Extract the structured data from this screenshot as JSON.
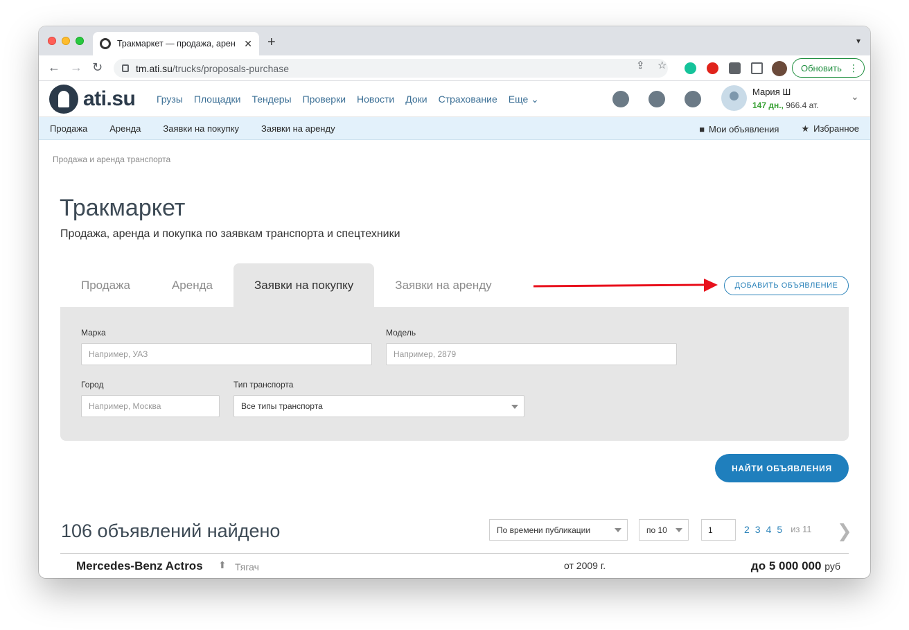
{
  "browser": {
    "tab_title": "Тракмаркет — продажа, арен",
    "url_host": "tm.ati.su",
    "url_path": "/trucks/proposals-purchase",
    "update_label": "Обновить"
  },
  "header": {
    "logo_text": "ati.su",
    "nav": [
      "Грузы",
      "Площадки",
      "Тендеры",
      "Проверки",
      "Новости",
      "Доки",
      "Страхование",
      "Еще"
    ],
    "user_name": "Мария Ш",
    "user_days": "147 дн.,",
    "user_balance": "966.4 ат."
  },
  "subnav": {
    "items": [
      "Продажа",
      "Аренда",
      "Заявки на покупку",
      "Заявки на аренду"
    ],
    "my_ads": "Мои объявления",
    "favorites": "Избранное"
  },
  "page": {
    "breadcrumb": "Продажа и аренда транспорта",
    "title": "Тракмаркет",
    "subtitle": "Продажа, аренда и покупка по заявкам транспорта и спецтехники",
    "tabs": [
      "Продажа",
      "Аренда",
      "Заявки на покупку",
      "Заявки на аренду"
    ],
    "active_tab": "Заявки на покупку",
    "add_button": "ДОБАВИТЬ ОБЪЯВЛЕНИЕ"
  },
  "filters": {
    "brand_label": "Марка",
    "brand_placeholder": "Например, УАЗ",
    "model_label": "Модель",
    "model_placeholder": "Например, 2879",
    "city_label": "Город",
    "city_placeholder": "Например, Москва",
    "type_label": "Тип транспорта",
    "type_value": "Все типы транспорта",
    "find_button": "НАЙТИ ОБЪЯВЛЕНИЯ"
  },
  "results": {
    "count_text": "106 объявлений найдено",
    "sort_value": "По времени публикации",
    "per_page": "по 10",
    "current_page": "1",
    "pages": [
      "2",
      "3",
      "4",
      "5"
    ],
    "of_total": "из 11",
    "items": [
      {
        "title": "Mercedes-Benz Actros",
        "type": "Тягач",
        "year": "от 2009 г.",
        "price_prefix": "до ",
        "price": "5 000 000",
        "currency": "руб"
      }
    ]
  },
  "colors": {
    "accent": "#1f7fbd",
    "annotation_arrow": "#e8101c",
    "subnav_bg": "#e3f1fb"
  }
}
